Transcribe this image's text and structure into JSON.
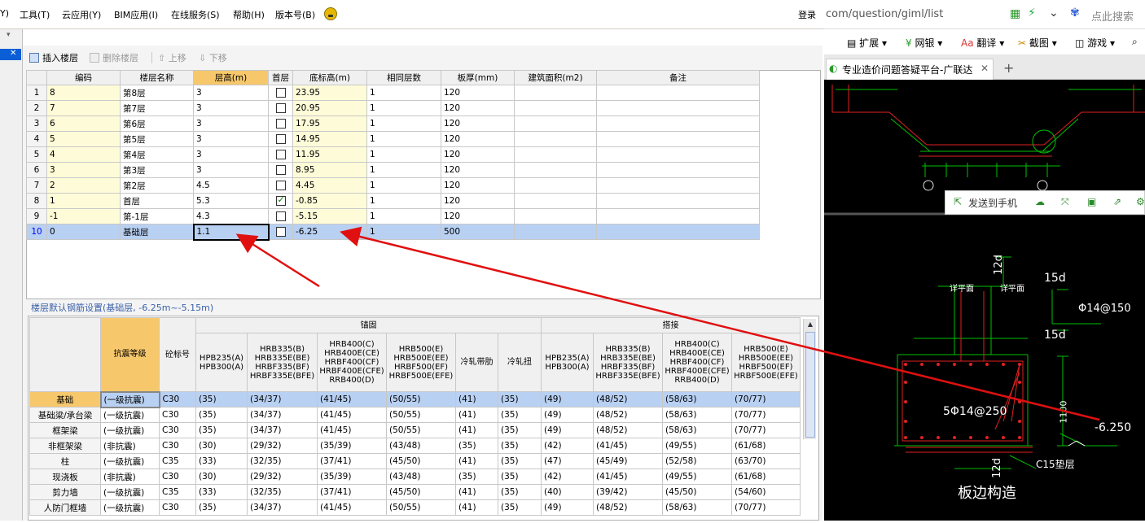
{
  "menubar": {
    "items": [
      "Y)",
      "工具(T)",
      "云应用(Y)",
      "BIM应用(I)",
      "在线服务(S)",
      "帮助(H)",
      "版本号(B)"
    ],
    "login": "登录"
  },
  "toolbar": {
    "insert_floor": "插入楼层",
    "delete_floor": "删除楼层",
    "move_up": "上移",
    "move_down": "下移"
  },
  "floor_table": {
    "headers": [
      "编码",
      "楼层名称",
      "层高(m)",
      "首层",
      "底标高(m)",
      "相同层数",
      "板厚(mm)",
      "建筑面积(m2)",
      "备注"
    ],
    "rows": [
      {
        "idx": "1",
        "code": "8",
        "name": "第8层",
        "height": "3",
        "first": false,
        "base": "23.95",
        "same": "1",
        "thick": "120"
      },
      {
        "idx": "2",
        "code": "7",
        "name": "第7层",
        "height": "3",
        "first": false,
        "base": "20.95",
        "same": "1",
        "thick": "120"
      },
      {
        "idx": "3",
        "code": "6",
        "name": "第6层",
        "height": "3",
        "first": false,
        "base": "17.95",
        "same": "1",
        "thick": "120"
      },
      {
        "idx": "4",
        "code": "5",
        "name": "第5层",
        "height": "3",
        "first": false,
        "base": "14.95",
        "same": "1",
        "thick": "120"
      },
      {
        "idx": "5",
        "code": "4",
        "name": "第4层",
        "height": "3",
        "first": false,
        "base": "11.95",
        "same": "1",
        "thick": "120"
      },
      {
        "idx": "6",
        "code": "3",
        "name": "第3层",
        "height": "3",
        "first": false,
        "base": "8.95",
        "same": "1",
        "thick": "120"
      },
      {
        "idx": "7",
        "code": "2",
        "name": "第2层",
        "height": "4.5",
        "first": false,
        "base": "4.45",
        "same": "1",
        "thick": "120"
      },
      {
        "idx": "8",
        "code": "1",
        "name": "首层",
        "height": "5.3",
        "first": true,
        "base": "-0.85",
        "same": "1",
        "thick": "120"
      },
      {
        "idx": "9",
        "code": "-1",
        "name": "第-1层",
        "height": "4.3",
        "first": false,
        "base": "-5.15",
        "same": "1",
        "thick": "120"
      },
      {
        "idx": "10",
        "code": "0",
        "name": "基础层",
        "height": "1.1",
        "first": false,
        "base": "-6.25",
        "same": "1",
        "thick": "500"
      }
    ]
  },
  "rebar_settings": {
    "title": "楼层默认钢筋设置(基础层, -6.25m~-5.15m)",
    "group_anchor": "锚固",
    "group_lap": "搭接",
    "col_grade": "抗震等级",
    "col_concrete": "砼标号",
    "steel_headers": [
      "HPB235(A)\nHPB300(A)",
      "HRB335(B)\nHRB335E(BE)\nHRBF335(BF)\nHRBF335E(BFE)",
      "HRB400(C)\nHRB400E(CE)\nHRBF400(CF)\nHRBF400E(CFE)\nRRB400(D)",
      "HRB500(E)\nHRB500E(EE)\nHRBF500(EF)\nHRBF500E(EFE)",
      "冷轧带肋",
      "冷轧扭"
    ],
    "rows": [
      {
        "name": "基础",
        "grade": "(一级抗震)",
        "conc": "C30",
        "anchor": [
          "(35)",
          "(34/37)",
          "(41/45)",
          "(50/55)",
          "(41)",
          "(35)"
        ],
        "lap": [
          "(49)",
          "(48/52)",
          "(58/63)",
          "(70/77)"
        ]
      },
      {
        "name": "基础梁/承台梁",
        "grade": "(一级抗震)",
        "conc": "C30",
        "anchor": [
          "(35)",
          "(34/37)",
          "(41/45)",
          "(50/55)",
          "(41)",
          "(35)"
        ],
        "lap": [
          "(49)",
          "(48/52)",
          "(58/63)",
          "(70/77)"
        ]
      },
      {
        "name": "框架梁",
        "grade": "(一级抗震)",
        "conc": "C30",
        "anchor": [
          "(35)",
          "(34/37)",
          "(41/45)",
          "(50/55)",
          "(41)",
          "(35)"
        ],
        "lap": [
          "(49)",
          "(48/52)",
          "(58/63)",
          "(70/77)"
        ]
      },
      {
        "name": "非框架梁",
        "grade": "(非抗震)",
        "conc": "C30",
        "anchor": [
          "(30)",
          "(29/32)",
          "(35/39)",
          "(43/48)",
          "(35)",
          "(35)"
        ],
        "lap": [
          "(42)",
          "(41/45)",
          "(49/55)",
          "(61/68)"
        ]
      },
      {
        "name": "柱",
        "grade": "(一级抗震)",
        "conc": "C35",
        "anchor": [
          "(33)",
          "(32/35)",
          "(37/41)",
          "(45/50)",
          "(41)",
          "(35)"
        ],
        "lap": [
          "(47)",
          "(45/49)",
          "(52/58)",
          "(63/70)"
        ]
      },
      {
        "name": "现浇板",
        "grade": "(非抗震)",
        "conc": "C30",
        "anchor": [
          "(30)",
          "(29/32)",
          "(35/39)",
          "(43/48)",
          "(35)",
          "(35)"
        ],
        "lap": [
          "(42)",
          "(41/45)",
          "(49/55)",
          "(61/68)"
        ]
      },
      {
        "name": "剪力墙",
        "grade": "(一级抗震)",
        "conc": "C35",
        "anchor": [
          "(33)",
          "(32/35)",
          "(37/41)",
          "(45/50)",
          "(41)",
          "(35)"
        ],
        "lap": [
          "(40)",
          "(39/42)",
          "(45/50)",
          "(54/60)"
        ]
      },
      {
        "name": "人防门框墙",
        "grade": "(一级抗震)",
        "conc": "C30",
        "anchor": [
          "(35)",
          "(34/37)",
          "(41/45)",
          "(50/55)",
          "(41)",
          "(35)"
        ],
        "lap": [
          "(49)",
          "(48/52)",
          "(58/63)",
          "(70/77)"
        ]
      }
    ]
  },
  "browser": {
    "url": "com/question/giml/list",
    "search_placeholder": "点此搜索",
    "bookmarks": [
      "扩展",
      "网银",
      "翻译",
      "截图",
      "游戏"
    ],
    "tab_title": "专业造价问题答疑平台-广联达",
    "send_to_phone": "发送到手机"
  },
  "cad": {
    "labels": {
      "dim_12d_top": "12d",
      "dim_15d_top": "15d",
      "dim_15d_mid": "15d",
      "rebar_top": "Φ14@150",
      "rebar_side": "5Φ14@250",
      "elev": "-6.250",
      "c15": "C15垫层",
      "dim_12d_bot": "12d",
      "title": "板边构造",
      "detail_l": "详平面",
      "detail_r": "详平面",
      "dim_1100": "1100"
    }
  },
  "colors": {
    "highlight": "#f7c86b",
    "selection": "#b8d0f2",
    "arrow": "#e01010",
    "cad_green": "#00c000",
    "cad_red": "#e02020"
  }
}
